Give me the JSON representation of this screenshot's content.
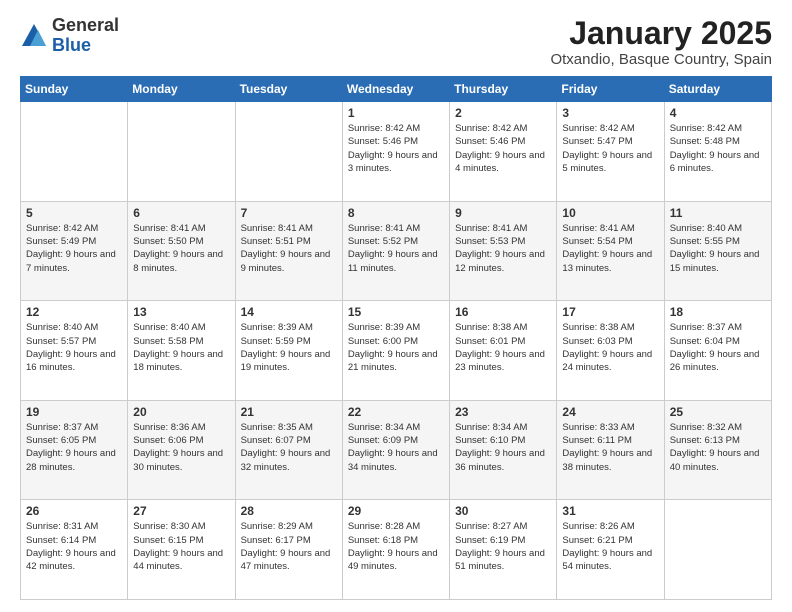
{
  "header": {
    "logo": {
      "line1": "General",
      "line2": "Blue"
    },
    "title": "January 2025",
    "subtitle": "Otxandio, Basque Country, Spain"
  },
  "weekdays": [
    "Sunday",
    "Monday",
    "Tuesday",
    "Wednesday",
    "Thursday",
    "Friday",
    "Saturday"
  ],
  "weeks": [
    [
      {
        "day": "",
        "content": ""
      },
      {
        "day": "",
        "content": ""
      },
      {
        "day": "",
        "content": ""
      },
      {
        "day": "1",
        "content": "Sunrise: 8:42 AM\nSunset: 5:46 PM\nDaylight: 9 hours and 3 minutes."
      },
      {
        "day": "2",
        "content": "Sunrise: 8:42 AM\nSunset: 5:46 PM\nDaylight: 9 hours and 4 minutes."
      },
      {
        "day": "3",
        "content": "Sunrise: 8:42 AM\nSunset: 5:47 PM\nDaylight: 9 hours and 5 minutes."
      },
      {
        "day": "4",
        "content": "Sunrise: 8:42 AM\nSunset: 5:48 PM\nDaylight: 9 hours and 6 minutes."
      }
    ],
    [
      {
        "day": "5",
        "content": "Sunrise: 8:42 AM\nSunset: 5:49 PM\nDaylight: 9 hours and 7 minutes."
      },
      {
        "day": "6",
        "content": "Sunrise: 8:41 AM\nSunset: 5:50 PM\nDaylight: 9 hours and 8 minutes."
      },
      {
        "day": "7",
        "content": "Sunrise: 8:41 AM\nSunset: 5:51 PM\nDaylight: 9 hours and 9 minutes."
      },
      {
        "day": "8",
        "content": "Sunrise: 8:41 AM\nSunset: 5:52 PM\nDaylight: 9 hours and 11 minutes."
      },
      {
        "day": "9",
        "content": "Sunrise: 8:41 AM\nSunset: 5:53 PM\nDaylight: 9 hours and 12 minutes."
      },
      {
        "day": "10",
        "content": "Sunrise: 8:41 AM\nSunset: 5:54 PM\nDaylight: 9 hours and 13 minutes."
      },
      {
        "day": "11",
        "content": "Sunrise: 8:40 AM\nSunset: 5:55 PM\nDaylight: 9 hours and 15 minutes."
      }
    ],
    [
      {
        "day": "12",
        "content": "Sunrise: 8:40 AM\nSunset: 5:57 PM\nDaylight: 9 hours and 16 minutes."
      },
      {
        "day": "13",
        "content": "Sunrise: 8:40 AM\nSunset: 5:58 PM\nDaylight: 9 hours and 18 minutes."
      },
      {
        "day": "14",
        "content": "Sunrise: 8:39 AM\nSunset: 5:59 PM\nDaylight: 9 hours and 19 minutes."
      },
      {
        "day": "15",
        "content": "Sunrise: 8:39 AM\nSunset: 6:00 PM\nDaylight: 9 hours and 21 minutes."
      },
      {
        "day": "16",
        "content": "Sunrise: 8:38 AM\nSunset: 6:01 PM\nDaylight: 9 hours and 23 minutes."
      },
      {
        "day": "17",
        "content": "Sunrise: 8:38 AM\nSunset: 6:03 PM\nDaylight: 9 hours and 24 minutes."
      },
      {
        "day": "18",
        "content": "Sunrise: 8:37 AM\nSunset: 6:04 PM\nDaylight: 9 hours and 26 minutes."
      }
    ],
    [
      {
        "day": "19",
        "content": "Sunrise: 8:37 AM\nSunset: 6:05 PM\nDaylight: 9 hours and 28 minutes."
      },
      {
        "day": "20",
        "content": "Sunrise: 8:36 AM\nSunset: 6:06 PM\nDaylight: 9 hours and 30 minutes."
      },
      {
        "day": "21",
        "content": "Sunrise: 8:35 AM\nSunset: 6:07 PM\nDaylight: 9 hours and 32 minutes."
      },
      {
        "day": "22",
        "content": "Sunrise: 8:34 AM\nSunset: 6:09 PM\nDaylight: 9 hours and 34 minutes."
      },
      {
        "day": "23",
        "content": "Sunrise: 8:34 AM\nSunset: 6:10 PM\nDaylight: 9 hours and 36 minutes."
      },
      {
        "day": "24",
        "content": "Sunrise: 8:33 AM\nSunset: 6:11 PM\nDaylight: 9 hours and 38 minutes."
      },
      {
        "day": "25",
        "content": "Sunrise: 8:32 AM\nSunset: 6:13 PM\nDaylight: 9 hours and 40 minutes."
      }
    ],
    [
      {
        "day": "26",
        "content": "Sunrise: 8:31 AM\nSunset: 6:14 PM\nDaylight: 9 hours and 42 minutes."
      },
      {
        "day": "27",
        "content": "Sunrise: 8:30 AM\nSunset: 6:15 PM\nDaylight: 9 hours and 44 minutes."
      },
      {
        "day": "28",
        "content": "Sunrise: 8:29 AM\nSunset: 6:17 PM\nDaylight: 9 hours and 47 minutes."
      },
      {
        "day": "29",
        "content": "Sunrise: 8:28 AM\nSunset: 6:18 PM\nDaylight: 9 hours and 49 minutes."
      },
      {
        "day": "30",
        "content": "Sunrise: 8:27 AM\nSunset: 6:19 PM\nDaylight: 9 hours and 51 minutes."
      },
      {
        "day": "31",
        "content": "Sunrise: 8:26 AM\nSunset: 6:21 PM\nDaylight: 9 hours and 54 minutes."
      },
      {
        "day": "",
        "content": ""
      }
    ]
  ]
}
